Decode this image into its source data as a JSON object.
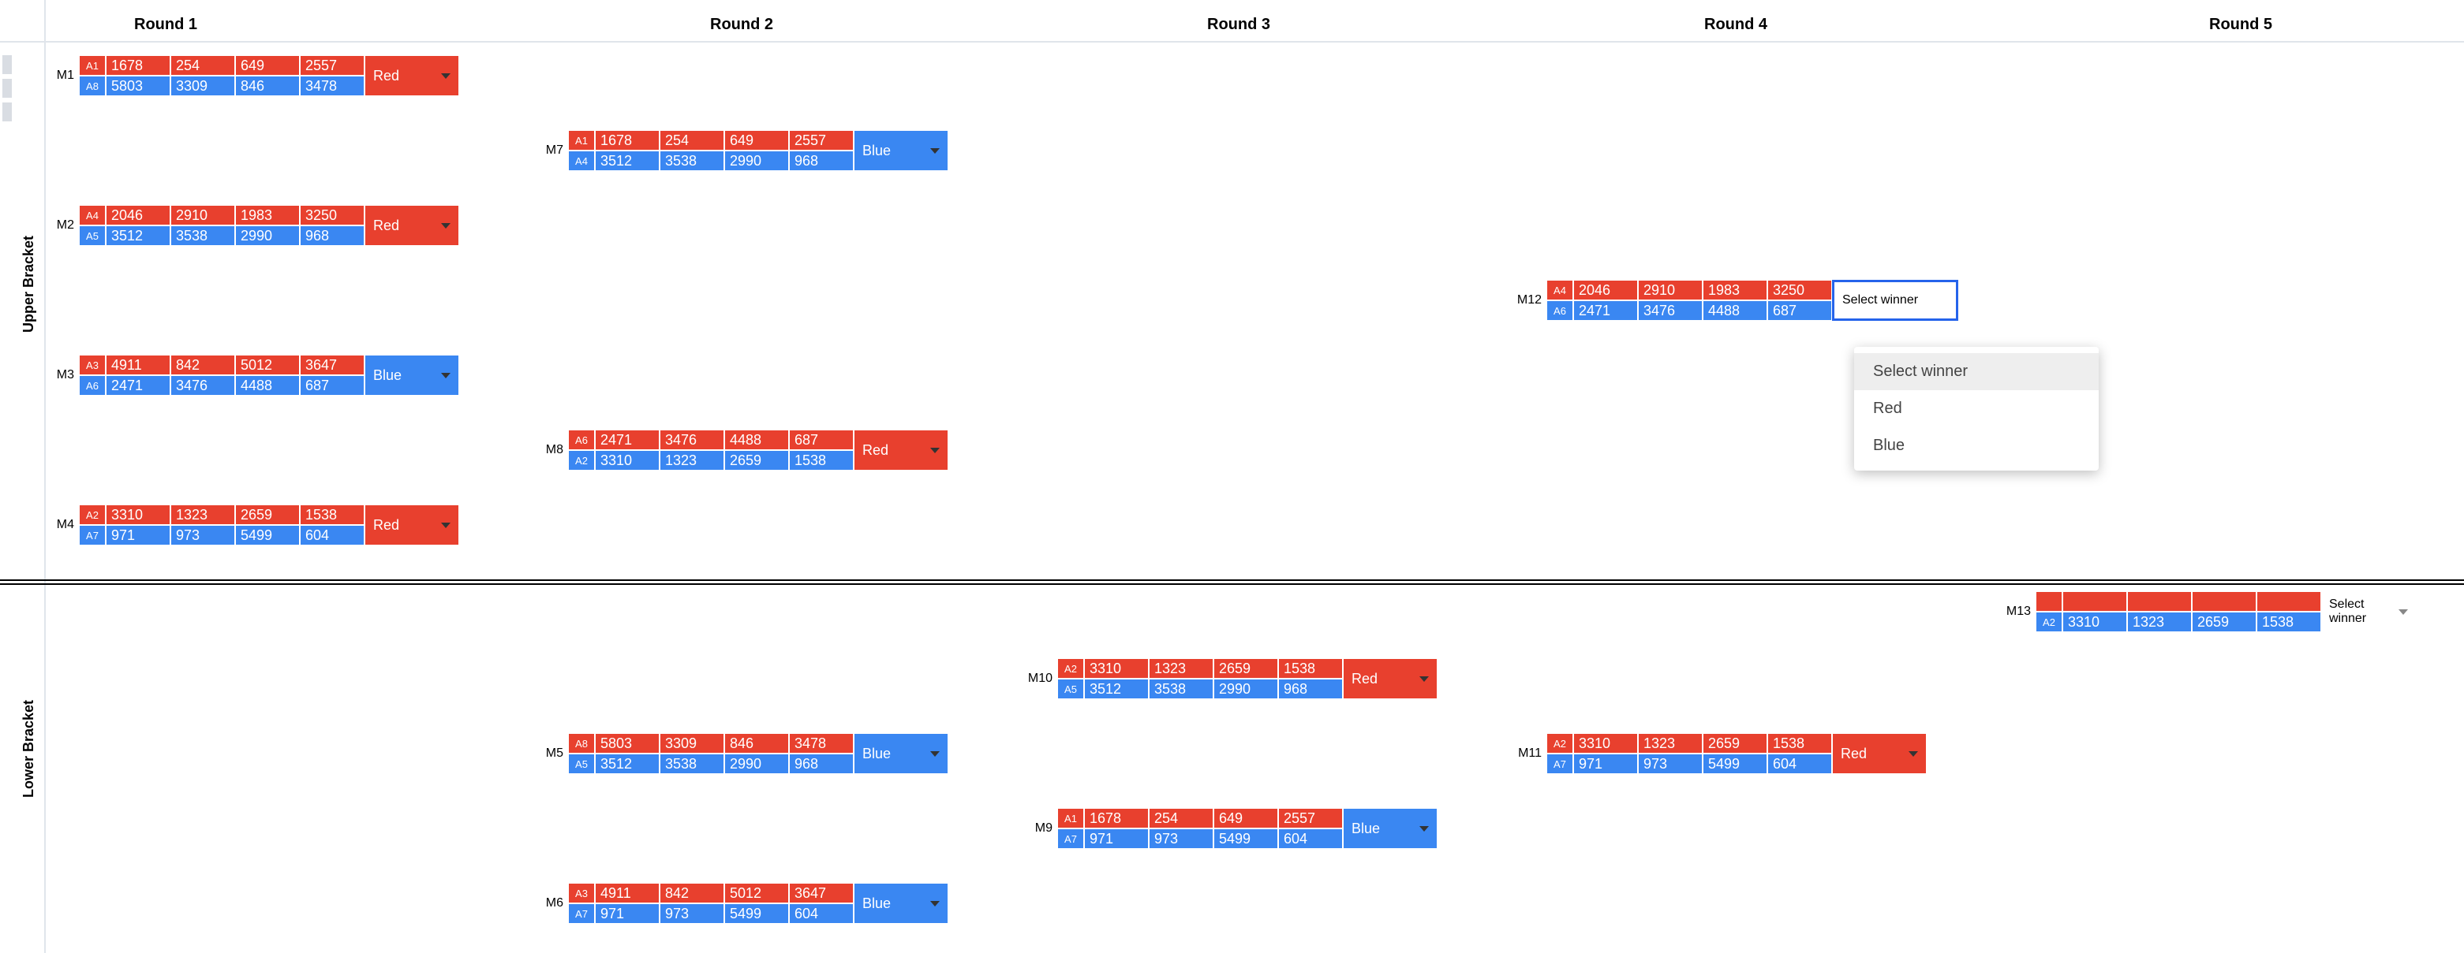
{
  "rounds": [
    "Round 1",
    "Round 2",
    "Round 3",
    "Round 4",
    "Round 5"
  ],
  "brackets": {
    "upper": "Upper Bracket",
    "lower": "Lower Bracket"
  },
  "winner_options": {
    "red": "Red",
    "blue": "Blue",
    "pending": "Select winner"
  },
  "dropdown": {
    "title": "Select winner",
    "opt_red": "Red",
    "opt_blue": "Blue"
  },
  "matches": {
    "M1": {
      "id": "M1",
      "red": {
        "seed": "A1",
        "t1": "1678",
        "t2": "254",
        "t3": "649",
        "t4": "2557"
      },
      "blue": {
        "seed": "A8",
        "t1": "5803",
        "t2": "3309",
        "t3": "846",
        "t4": "3478"
      },
      "winner": "red"
    },
    "M2": {
      "id": "M2",
      "red": {
        "seed": "A4",
        "t1": "2046",
        "t2": "2910",
        "t3": "1983",
        "t4": "3250"
      },
      "blue": {
        "seed": "A5",
        "t1": "3512",
        "t2": "3538",
        "t3": "2990",
        "t4": "968"
      },
      "winner": "red"
    },
    "M3": {
      "id": "M3",
      "red": {
        "seed": "A3",
        "t1": "4911",
        "t2": "842",
        "t3": "5012",
        "t4": "3647"
      },
      "blue": {
        "seed": "A6",
        "t1": "2471",
        "t2": "3476",
        "t3": "4488",
        "t4": "687"
      },
      "winner": "blue"
    },
    "M4": {
      "id": "M4",
      "red": {
        "seed": "A2",
        "t1": "3310",
        "t2": "1323",
        "t3": "2659",
        "t4": "1538"
      },
      "blue": {
        "seed": "A7",
        "t1": "971",
        "t2": "973",
        "t3": "5499",
        "t4": "604"
      },
      "winner": "red"
    },
    "M5": {
      "id": "M5",
      "red": {
        "seed": "A8",
        "t1": "5803",
        "t2": "3309",
        "t3": "846",
        "t4": "3478"
      },
      "blue": {
        "seed": "A5",
        "t1": "3512",
        "t2": "3538",
        "t3": "2990",
        "t4": "968"
      },
      "winner": "blue"
    },
    "M6": {
      "id": "M6",
      "red": {
        "seed": "A3",
        "t1": "4911",
        "t2": "842",
        "t3": "5012",
        "t4": "3647"
      },
      "blue": {
        "seed": "A7",
        "t1": "971",
        "t2": "973",
        "t3": "5499",
        "t4": "604"
      },
      "winner": "blue"
    },
    "M7": {
      "id": "M7",
      "red": {
        "seed": "A1",
        "t1": "1678",
        "t2": "254",
        "t3": "649",
        "t4": "2557"
      },
      "blue": {
        "seed": "A4",
        "t1": "3512",
        "t2": "3538",
        "t3": "2990",
        "t4": "968"
      },
      "winner": "blue"
    },
    "M8": {
      "id": "M8",
      "red": {
        "seed": "A6",
        "t1": "2471",
        "t2": "3476",
        "t3": "4488",
        "t4": "687"
      },
      "blue": {
        "seed": "A2",
        "t1": "3310",
        "t2": "1323",
        "t3": "2659",
        "t4": "1538"
      },
      "winner": "red"
    },
    "M9": {
      "id": "M9",
      "red": {
        "seed": "A1",
        "t1": "1678",
        "t2": "254",
        "t3": "649",
        "t4": "2557"
      },
      "blue": {
        "seed": "A7",
        "t1": "971",
        "t2": "973",
        "t3": "5499",
        "t4": "604"
      },
      "winner": "blue"
    },
    "M10": {
      "id": "M10",
      "red": {
        "seed": "A2",
        "t1": "3310",
        "t2": "1323",
        "t3": "2659",
        "t4": "1538"
      },
      "blue": {
        "seed": "A5",
        "t1": "3512",
        "t2": "3538",
        "t3": "2990",
        "t4": "968"
      },
      "winner": "red"
    },
    "M11": {
      "id": "M11",
      "red": {
        "seed": "A2",
        "t1": "3310",
        "t2": "1323",
        "t3": "2659",
        "t4": "1538"
      },
      "blue": {
        "seed": "A7",
        "t1": "971",
        "t2": "973",
        "t3": "5499",
        "t4": "604"
      },
      "winner": "red"
    },
    "M12": {
      "id": "M12",
      "red": {
        "seed": "A4",
        "t1": "2046",
        "t2": "2910",
        "t3": "1983",
        "t4": "3250"
      },
      "blue": {
        "seed": "A6",
        "t1": "2471",
        "t2": "3476",
        "t3": "4488",
        "t4": "687"
      },
      "winner": "pending"
    },
    "M13": {
      "id": "M13",
      "red": {
        "seed": "",
        "t1": "",
        "t2": "",
        "t3": "",
        "t4": ""
      },
      "blue": {
        "seed": "A2",
        "t1": "3310",
        "t2": "1323",
        "t3": "2659",
        "t4": "1538"
      },
      "winner": "plain"
    }
  }
}
